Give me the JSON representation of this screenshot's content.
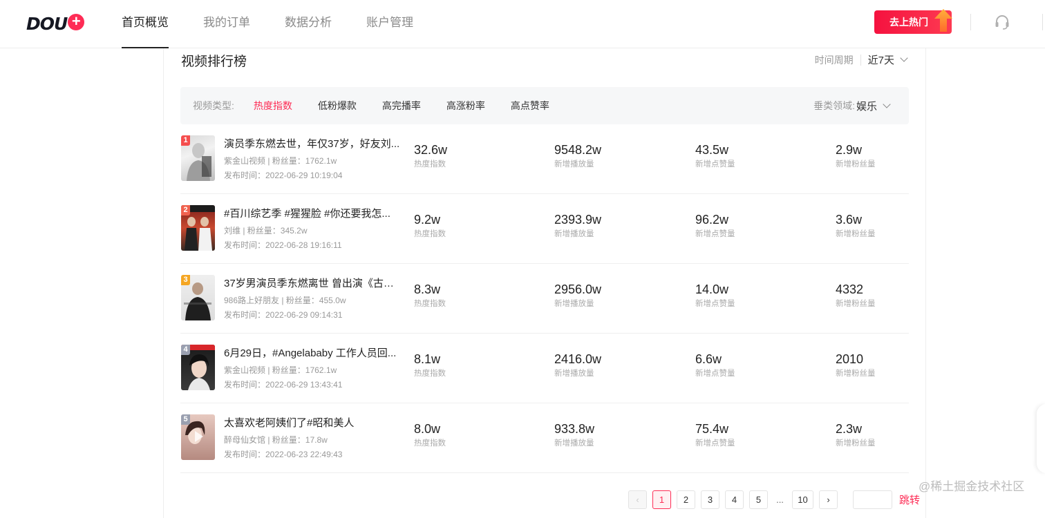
{
  "header": {
    "logo_text": "DOU",
    "logo_plus": "+",
    "nav": [
      {
        "label": "首页概览",
        "active": true
      },
      {
        "label": "我的订单",
        "active": false
      },
      {
        "label": "数据分析",
        "active": false
      },
      {
        "label": "账户管理",
        "active": false
      }
    ],
    "hot_button": "去上热门",
    "support_icon": "headset-icon"
  },
  "ranking": {
    "title": "视频排行榜",
    "period_label": "时间周期",
    "period_value": "近7天",
    "filter": {
      "label": "视频类型:",
      "options": [
        {
          "label": "热度指数",
          "active": true
        },
        {
          "label": "低粉爆款",
          "active": false
        },
        {
          "label": "高完播率",
          "active": false
        },
        {
          "label": "高涨粉率",
          "active": false
        },
        {
          "label": "高点赞率",
          "active": false
        }
      ],
      "domain_label": "垂类领域:",
      "domain_value": "娱乐"
    },
    "stat_labels": [
      "热度指数",
      "新增播放量",
      "新增点赞量",
      "新增粉丝量"
    ],
    "rows": [
      {
        "rank": "1",
        "title": "演员季东燃去世，年仅37岁，好友刘...",
        "meta": "紫金山视频 | 粉丝量：1762.1w",
        "time": "发布时间：2022-06-29 10:19:04",
        "heat": "32.6w",
        "plays": "9548.2w",
        "likes": "43.5w",
        "fans": "2.9w"
      },
      {
        "rank": "2",
        "title": "#百川综艺季 #猩猩脸 #你还要我怎...",
        "meta": "刘维 | 粉丝量：345.2w",
        "time": "发布时间：2022-06-28 19:16:11",
        "heat": "9.2w",
        "plays": "2393.9w",
        "likes": "96.2w",
        "fans": "3.6w"
      },
      {
        "rank": "3",
        "title": "37岁男演员季东燃离世 曾出演《古剑...",
        "meta": "986路上好朋友 | 粉丝量：455.0w",
        "time": "发布时间：2022-06-29 09:14:31",
        "heat": "8.3w",
        "plays": "2956.0w",
        "likes": "14.0w",
        "fans": "4332"
      },
      {
        "rank": "4",
        "title": "6月29日，#Angelababy 工作人员回...",
        "meta": "紫金山视频 | 粉丝量：1762.1w",
        "time": "发布时间：2022-06-29 13:43:41",
        "heat": "8.1w",
        "plays": "2416.0w",
        "likes": "6.6w",
        "fans": "2010"
      },
      {
        "rank": "5",
        "title": "太喜欢老阿姨们了#昭和美人",
        "meta": "醉母仙女馆 | 粉丝量：17.8w",
        "time": "发布时间：2022-06-23 22:49:43",
        "heat": "8.0w",
        "plays": "933.8w",
        "likes": "75.4w",
        "fans": "2.3w"
      }
    ],
    "rank_colors": [
      "#f54e4e",
      "#f0624e",
      "#f5a623",
      "#9aa0b0",
      "#9aa0b0"
    ]
  },
  "pagination": {
    "prev": "‹",
    "pages": [
      "1",
      "2",
      "3",
      "4",
      "5"
    ],
    "ellipsis": "...",
    "last": "10",
    "next": "›",
    "current": "1",
    "jump_label": "跳转"
  },
  "watermark": "@稀土掘金技术社区"
}
